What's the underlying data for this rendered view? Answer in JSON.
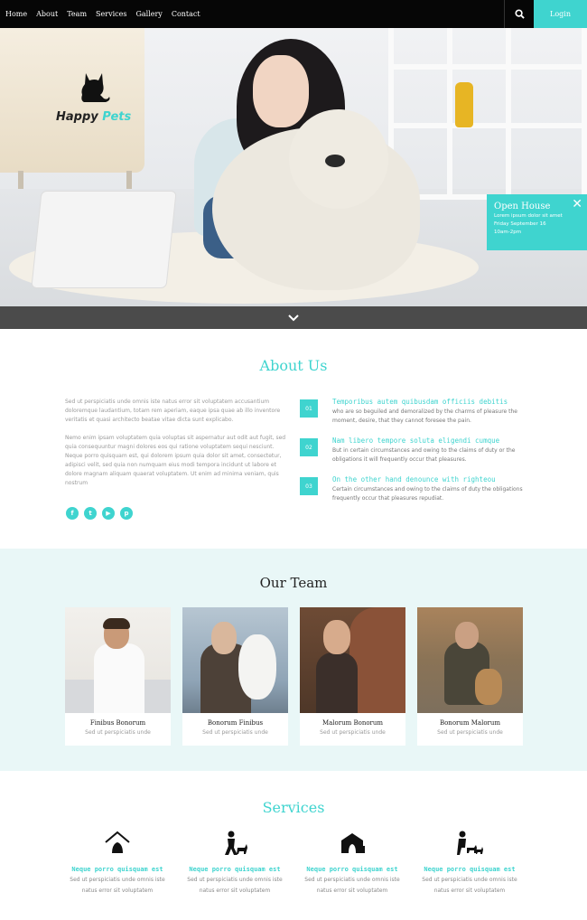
{
  "nav": {
    "links": [
      "Home",
      "About",
      "Team",
      "Services",
      "Gallery",
      "Contact"
    ],
    "login_label": "Login",
    "search_icon": "search-icon"
  },
  "hero": {
    "logo": {
      "word1": "Happy",
      "word2": "Pets",
      "icon": "cat-icon"
    },
    "open_house": {
      "title": "Open House",
      "lines": [
        "Lorem ipsum dolor sit amet",
        "Friday September 16",
        "10am-2pm"
      ],
      "close_icon": "close-icon"
    },
    "scroll_icon": "chevron-down-icon"
  },
  "about": {
    "title": "About Us",
    "paragraphs": [
      "Sed ut perspiciatis unde omnis iste natus error sit voluptatem accusantium doloremque laudantium, totam rem aperiam, eaque ipsa quae ab illo inventore veritatis et quasi architecto beatae vitae dicta sunt explicabo.",
      "Nemo enim ipsam voluptatem quia voluptas sit aspernatur aut odit aut fugit, sed quia consequuntur magni dolores eos qui ratione voluptatem sequi nesciunt. Neque porro quisquam est, qui dolorem ipsum quia dolor sit amet, consectetur, adipisci velit, sed quia non numquam eius modi tempora incidunt ut labore et dolore magnam aliquam quaerat voluptatem. Ut enim ad minima veniam, quis nostrum"
    ],
    "socials": [
      {
        "icon": "facebook-icon",
        "glyph": "f"
      },
      {
        "icon": "twitter-icon",
        "glyph": "t"
      },
      {
        "icon": "youtube-icon",
        "glyph": "▶"
      },
      {
        "icon": "pinterest-icon",
        "glyph": "p"
      }
    ],
    "features": [
      {
        "icon_label": "01",
        "title": "Temporibus autem quibusdam officiis debitis",
        "text": "who are so beguiled and demoralized by the charms of pleasure the moment, desire, that they cannot foresee the pain."
      },
      {
        "icon_label": "02",
        "title": "Nam libero tempore soluta eligendi cumque",
        "text": "But in certain circumstances and owing to the claims of duty or the obligations it will frequently occur that pleasures."
      },
      {
        "icon_label": "03",
        "title": "On the other hand denounce with righteou",
        "text": "Certain circumstances and owing to the claims of duty the obligations frequently occur that pleasures repudiat."
      }
    ]
  },
  "team": {
    "title": "Our Team",
    "members": [
      {
        "name": "Finibus Bonorum",
        "role": "Sed ut perspiciatis unde"
      },
      {
        "name": "Bonorum Finibus",
        "role": "Sed ut perspiciatis unde"
      },
      {
        "name": "Malorum Bonorum",
        "role": "Sed ut perspiciatis unde"
      },
      {
        "name": "Bonorum Malorum",
        "role": "Sed ut perspiciatis unde"
      }
    ]
  },
  "services": {
    "title": "Services",
    "items": [
      {
        "icon": "dog-house-icon",
        "title": "Neque porro quisquam est",
        "text": "Sed ut perspiciatis unde omnis iste natus error sit voluptatem"
      },
      {
        "icon": "person-dog-icon",
        "title": "Neque porro quisquam est",
        "text": "Sed ut perspiciatis unde omnis iste natus error sit voluptatem"
      },
      {
        "icon": "kennel-icon",
        "title": "Neque porro quisquam est",
        "text": "Sed ut perspiciatis unde omnis iste natus error sit voluptatem"
      },
      {
        "icon": "dog-walker-icon",
        "title": "Neque porro quisquam est",
        "text": "Sed ut perspiciatis unde omnis iste natus error sit voluptatem"
      }
    ]
  },
  "colors": {
    "accent": "#3fd4cf",
    "nav_bg": "#060606",
    "team_bg": "#e9f7f7"
  }
}
